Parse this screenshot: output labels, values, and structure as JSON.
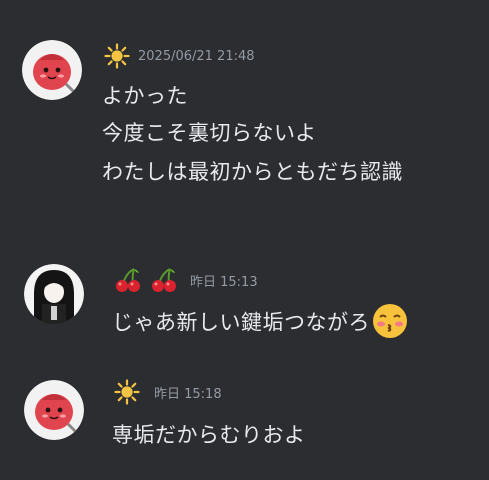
{
  "messages": [
    {
      "user_icon": "sun-icon",
      "timestamp": "2025/06/21 21:48",
      "lines": [
        "よかった",
        "今度こそ裏切らないよ",
        "わたしは最初からともだち認識"
      ]
    },
    {
      "user_icon": "cherries-icon",
      "timestamp": "昨日 15:13",
      "lines": [
        "じゃあ新しい鍵垢つながろ"
      ],
      "emoji": "kissing-face-icon"
    },
    {
      "user_icon": "sun-icon",
      "timestamp": "昨日 15:18",
      "lines": [
        "専垢だからむりおよ"
      ]
    }
  ],
  "colors": {
    "background": "#2b2d31",
    "text": "#e7e9ec",
    "timestamp": "#949ba4",
    "sun": "#f4c542",
    "cherry": "#d9232e",
    "avatar_red": "#e0444e"
  }
}
